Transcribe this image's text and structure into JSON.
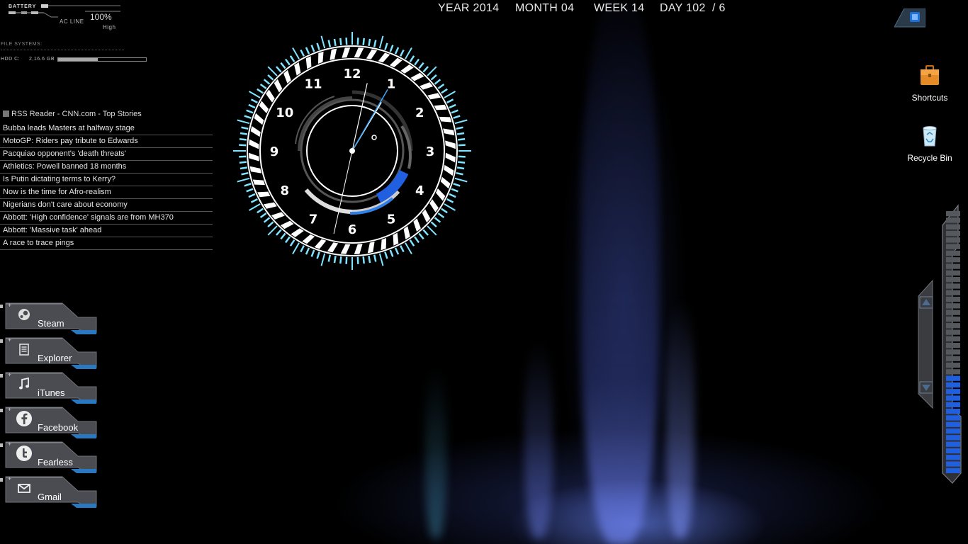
{
  "calendar": {
    "year": "YEAR 2014",
    "month": "MONTH 04",
    "week": "WEEK 14",
    "day": "DAY 102",
    "weekday": "/ 6"
  },
  "battery": {
    "label": "BATTERY",
    "source": "AC LINE",
    "percent": "100%",
    "mode": "High",
    "level": 1.0
  },
  "drives": {
    "section_label": "FILE SYSTEMS:",
    "name": "HDD C:",
    "size": "2,16.6 GB",
    "used_fraction": 0.45
  },
  "rss": {
    "title": "RSS Reader - CNN.com - Top Stories",
    "items": [
      "Bubba leads Masters at halfway stage",
      "MotoGP: Riders pay tribute to Edwards",
      "Pacquiao opponent's 'death threats'",
      "Athletics: Powell banned 18 months",
      "Is Putin dictating terms to Kerry?",
      "Now is the time for Afro-realism",
      "Nigerians don't care about economy",
      "Abbott: 'High confidence' signals are from MH370",
      "Abbott: 'Massive task' ahead",
      "A race to trace pings"
    ]
  },
  "clock": {
    "numbers": [
      "12",
      "1",
      "2",
      "3",
      "4",
      "5",
      "6",
      "7",
      "8",
      "9",
      "10",
      "11"
    ],
    "hour": 1,
    "minute": 2,
    "second": 5
  },
  "launchers": [
    {
      "label": "Steam",
      "icon": "steam-icon"
    },
    {
      "label": "Explorer",
      "icon": "explorer-icon"
    },
    {
      "label": "iTunes",
      "icon": "music-note-icon"
    },
    {
      "label": "Facebook",
      "icon": "facebook-icon"
    },
    {
      "label": "Fearless",
      "icon": "twitter-icon"
    },
    {
      "label": "Gmail",
      "icon": "mail-icon"
    }
  ],
  "desktop_icons": {
    "shortcuts": {
      "label": "Shortcuts",
      "icon": "briefcase-icon"
    },
    "recycle": {
      "label": "Recycle Bin",
      "icon": "recycle-bin-icon"
    }
  },
  "volume": {
    "level": 0.38,
    "up_icon": "arrow-up-icon",
    "down_icon": "arrow-down-icon"
  },
  "colors": {
    "accent_blue": "#1f5fe0",
    "ring_cyan": "#7fe4ff",
    "second_hand": "#3aa8ff"
  }
}
